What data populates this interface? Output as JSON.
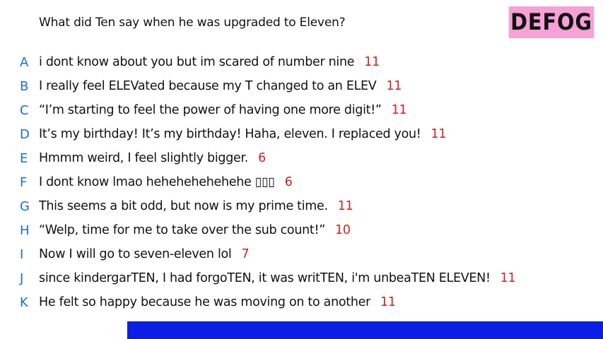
{
  "question": "What did Ten say when he was upgraded to Eleven?",
  "logo_text": "DEFOG",
  "colors": {
    "letter": "#1d6fc9",
    "score": "#d11f1f",
    "logo_bg": "#f7a1d6",
    "bottom_bar": "#0a1ee6"
  },
  "answers": [
    {
      "letter": "A",
      "text": "i dont know about you but im scared of number nine",
      "score": "11"
    },
    {
      "letter": "B",
      "text": "I really feel ELEVated because my T changed to an ELEV",
      "score": "11"
    },
    {
      "letter": "C",
      "text": "“I’m starting to feel the power of having one more digit!”",
      "score": "11"
    },
    {
      "letter": "D",
      "text": "It’s my birthday! It’s my birthday! Haha, eleven. I replaced you!",
      "score": "11"
    },
    {
      "letter": "E",
      "text": "Hmmm weird, I feel slightly bigger.",
      "score": "6"
    },
    {
      "letter": "F",
      "text": "I dont know lmao hehehehehehehe ▯▯▯",
      "score": "6"
    },
    {
      "letter": "G",
      "text": "This seems a bit odd, but now is my prime time.",
      "score": "11"
    },
    {
      "letter": "H",
      "text": "“Welp, time for me to take over the sub count!”",
      "score": "10"
    },
    {
      "letter": "I",
      "text": "Now I will go to seven-eleven lol",
      "score": "7"
    },
    {
      "letter": "J",
      "text": "since kindergarTEN, I had forgoTEN, it was writTEN, i'm unbeaTEN ELEVEN!",
      "score": "11"
    },
    {
      "letter": "K",
      "text": "He felt so happy because he was moving on to another",
      "score": "11"
    }
  ]
}
